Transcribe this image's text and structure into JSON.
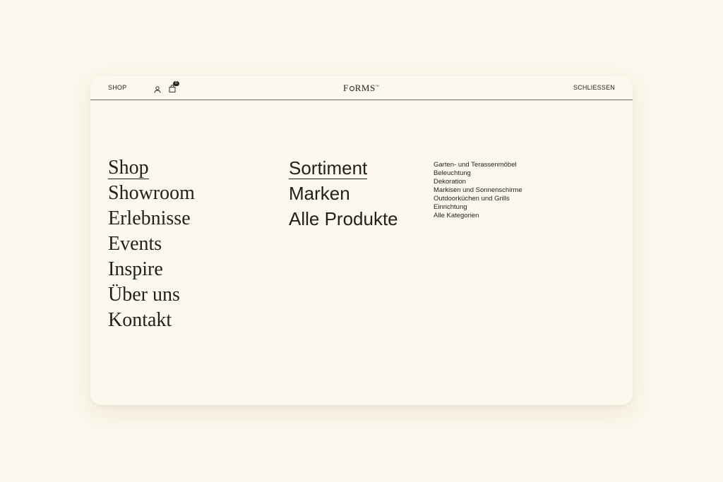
{
  "header": {
    "shop_label": "SHOP",
    "cart_count": "0",
    "logo_letters": [
      "F",
      "RMS"
    ],
    "logo_mark": "™",
    "close_label": "SCHLIESSEN",
    "icons": [
      "user-icon",
      "shopping-bag-icon"
    ]
  },
  "main_nav": [
    {
      "label": "Shop",
      "active": true
    },
    {
      "label": "Showroom",
      "active": false
    },
    {
      "label": "Erlebnisse",
      "active": false
    },
    {
      "label": "Events",
      "active": false
    },
    {
      "label": "Inspire",
      "active": false
    },
    {
      "label": "Über uns",
      "active": false
    },
    {
      "label": "Kontakt",
      "active": false
    }
  ],
  "shop_nav": [
    {
      "label": "Sortiment",
      "active": true
    },
    {
      "label": "Marken",
      "active": false
    },
    {
      "label": "Alle Produkte",
      "active": false
    }
  ],
  "sortiment_nav": [
    {
      "label": "Garten- und Terassenmöbel"
    },
    {
      "label": "Beleuchtung"
    },
    {
      "label": "Dekoration"
    },
    {
      "label": "Markisen und Sonnenschirme"
    },
    {
      "label": "Outdoorküchen und Grills"
    },
    {
      "label": "Einrichtung"
    },
    {
      "label": "Alle Kategorien"
    }
  ],
  "colors": {
    "page_background": "#fcf7ec",
    "panel_background": "#fdf8ed",
    "text": "#231f1a",
    "divider": "#6b6258"
  }
}
